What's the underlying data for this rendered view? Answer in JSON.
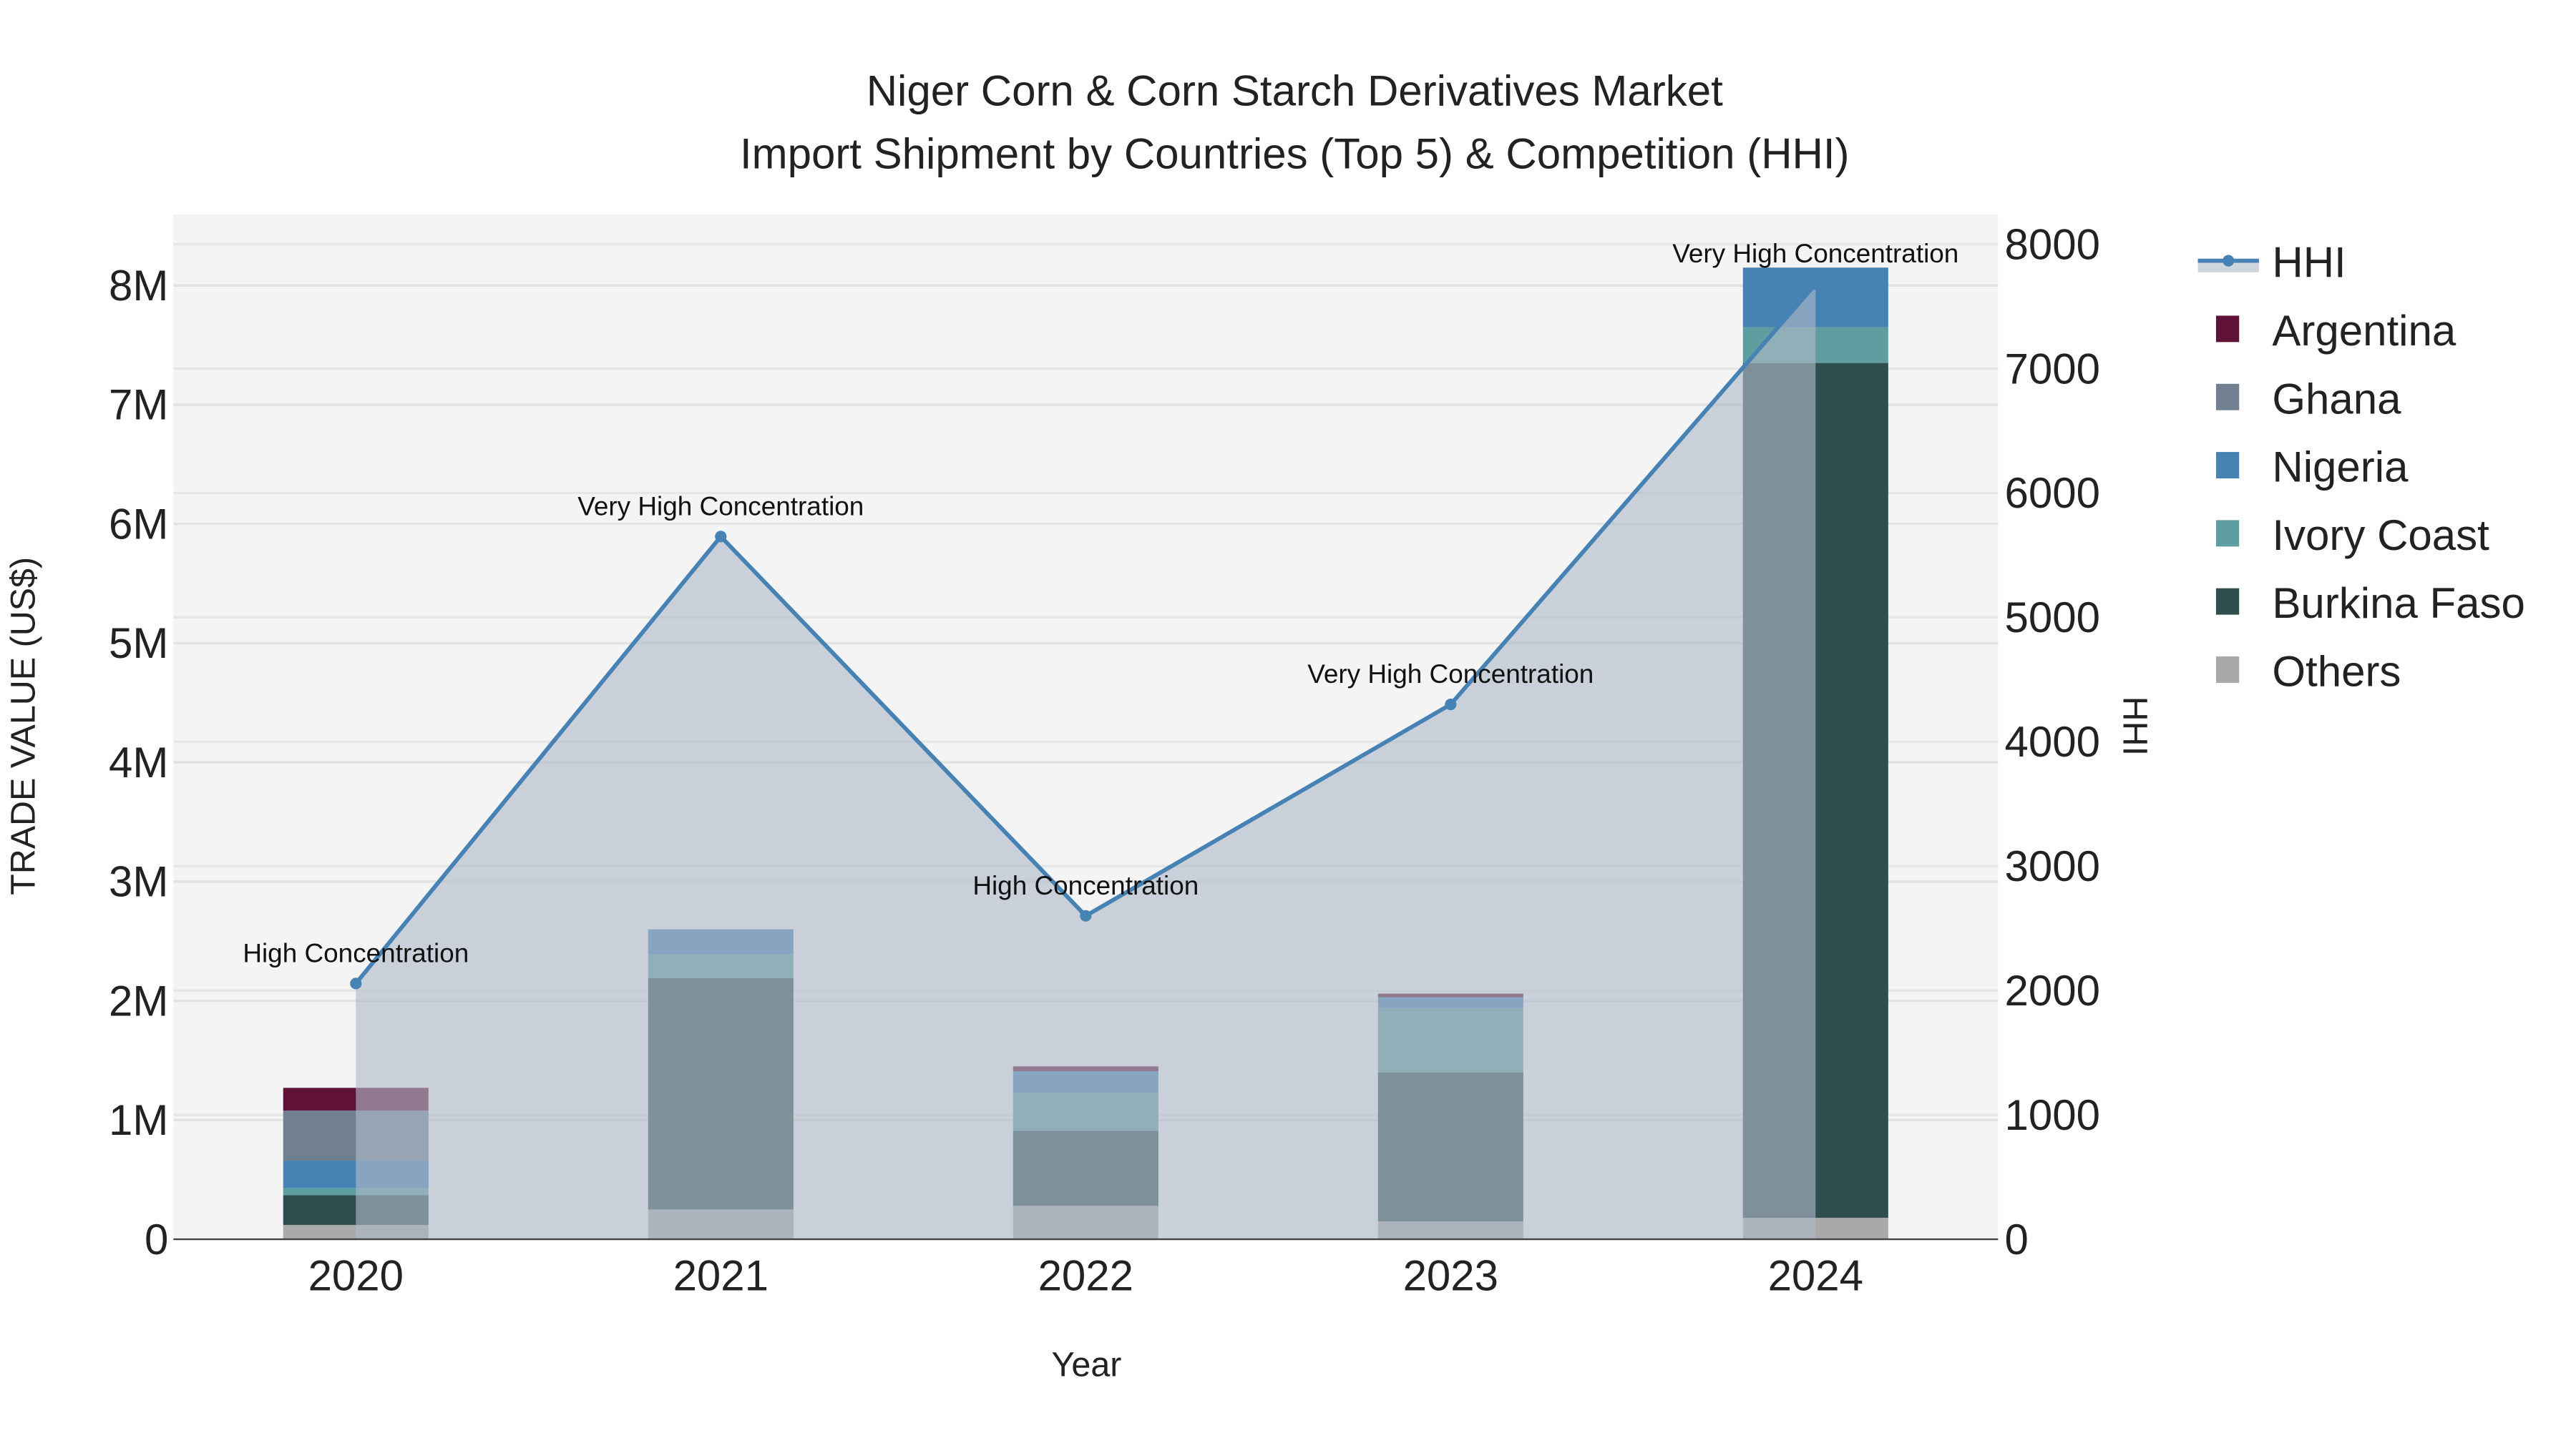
{
  "chart_data": {
    "type": "bar",
    "title_line1": "Niger Corn & Corn Starch Derivatives Market",
    "title_line2": "Import Shipment by Countries (Top 5) & Competition (HHI)",
    "xlabel": "Year",
    "ylabel": "TRADE VALUE (US$)",
    "y2label": "HHI",
    "categories": [
      "2020",
      "2021",
      "2022",
      "2023",
      "2024"
    ],
    "ylim": [
      0,
      8600000
    ],
    "y2lim": [
      0,
      8250
    ],
    "yticks": [
      0,
      1000000,
      2000000,
      3000000,
      4000000,
      5000000,
      6000000,
      7000000,
      8000000
    ],
    "ytick_labels": [
      "0",
      "1M",
      "2M",
      "3M",
      "4M",
      "5M",
      "6M",
      "7M",
      "8M"
    ],
    "y2ticks": [
      0,
      1000,
      2000,
      3000,
      4000,
      5000,
      6000,
      7000,
      8000
    ],
    "y2tick_labels": [
      "0",
      "1000",
      "2000",
      "3000",
      "4000",
      "5000",
      "6000",
      "7000",
      "8000"
    ],
    "series": [
      {
        "name": "Others",
        "color": "#a9a9a9",
        "values": [
          120000,
          250000,
          280000,
          150000,
          180000
        ]
      },
      {
        "name": "Burkina Faso",
        "color": "#2f4f4f",
        "values": [
          250000,
          1940000,
          630000,
          1250000,
          7170000
        ]
      },
      {
        "name": "Ivory Coast",
        "color": "#5f9ea0",
        "values": [
          60000,
          200000,
          320000,
          540000,
          300000
        ]
      },
      {
        "name": "Nigeria",
        "color": "#4682b4",
        "values": [
          230000,
          210000,
          180000,
          90000,
          500000
        ]
      },
      {
        "name": "Ghana",
        "color": "#708090",
        "values": [
          420000,
          0,
          0,
          0,
          0
        ]
      },
      {
        "name": "Argentina",
        "color": "#5f1136",
        "values": [
          190000,
          0,
          40000,
          30000,
          0
        ]
      }
    ],
    "hhi": {
      "name": "HHI",
      "color": "#4682b4",
      "values": [
        2056,
        5650,
        2600,
        4300,
        7680
      ],
      "annotations": [
        "High Concentration",
        "Very High Concentration",
        "High Concentration",
        "Very High Concentration",
        "Very High Concentration"
      ]
    },
    "legend": [
      "HHI",
      "Argentina",
      "Ghana",
      "Nigeria",
      "Ivory Coast",
      "Burkina Faso",
      "Others"
    ],
    "legend_placement": "right",
    "grid": true
  }
}
